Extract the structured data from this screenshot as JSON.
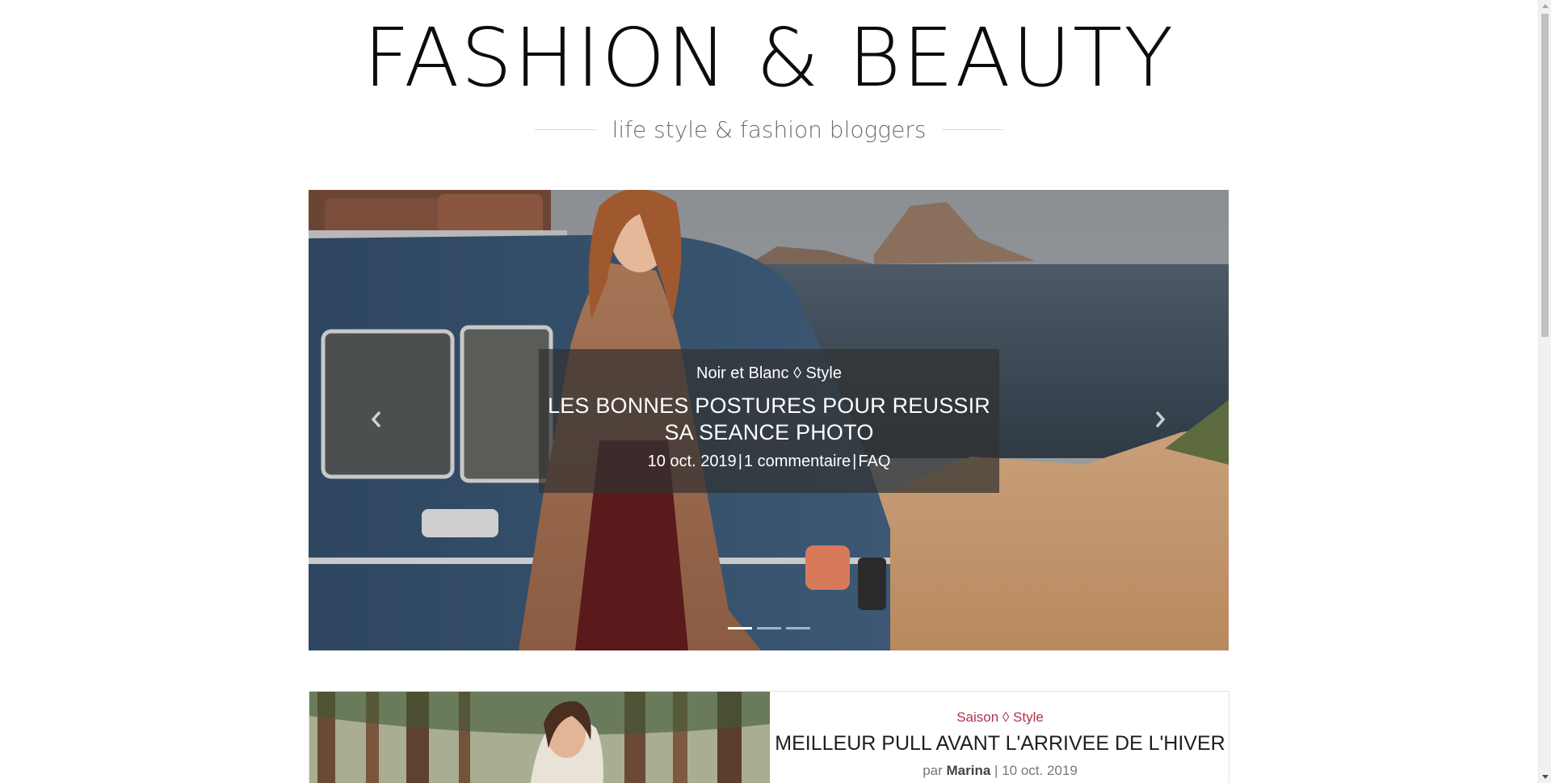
{
  "header": {
    "site_title": "FASHION & BEAUTY",
    "tagline": "life style & fashion bloggers"
  },
  "slider": {
    "caption": {
      "categories": "Noir et Blanc ◊ Style",
      "title": "LES BONNES POSTURES POUR REUSSIR SA SEANCE PHOTO",
      "date": "10 oct. 2019",
      "separator": "|",
      "comments": "1 commentaire",
      "tag": "FAQ"
    },
    "indicators": [
      {
        "active": true
      },
      {
        "active": false
      },
      {
        "active": false
      }
    ],
    "prev_icon": "chevron-left-icon",
    "next_icon": "chevron-right-icon"
  },
  "article": {
    "categories": "Saison ◊ Style",
    "title": "MEILLEUR PULL AVANT L'ARRIVEE DE L'HIVER",
    "by_label": "par",
    "author": "Marina",
    "separator": "|",
    "date": "10 oct. 2019"
  },
  "colors": {
    "accent": "#b0324d",
    "caption_bg": "#323232"
  }
}
